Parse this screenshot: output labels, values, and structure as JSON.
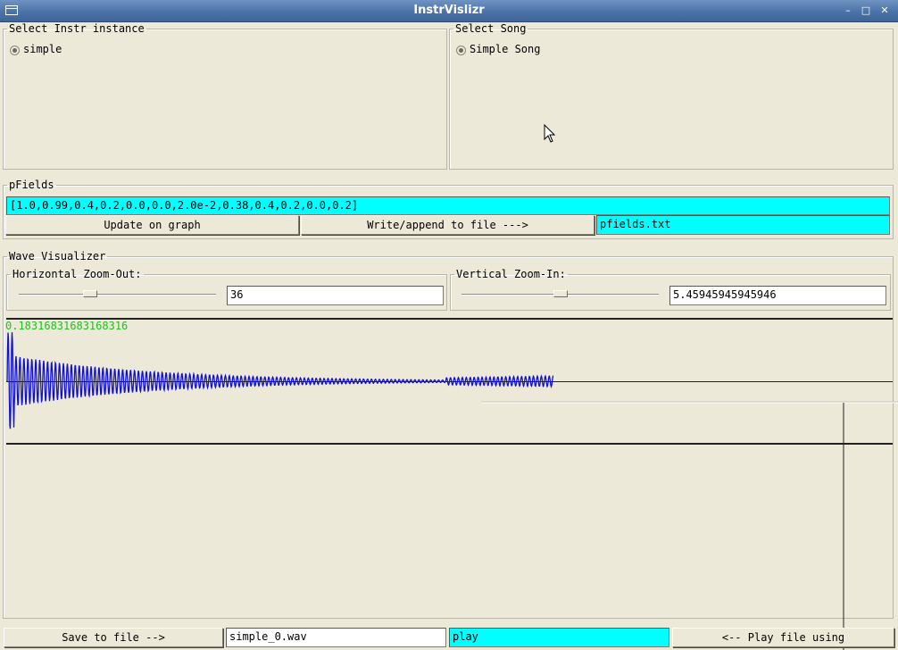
{
  "window": {
    "title": "InstrVislizr"
  },
  "instr_panel": {
    "legend": "Select Instr instance",
    "options": [
      {
        "label": "simple",
        "selected": true
      }
    ]
  },
  "song_panel": {
    "legend": "Select Song",
    "options": [
      {
        "label": "Simple Song",
        "selected": true
      }
    ]
  },
  "pfields": {
    "legend": "pFields",
    "value": "[1.0,0.99,0.4,0.2,0.0,0.0,2.0e-2,0.38,0.4,0.2,0.0,0.2]",
    "update_label": "Update on graph",
    "write_label": "Write/append to file --->",
    "filename": "pfields.txt"
  },
  "visualizer": {
    "legend": "Wave Visualizer",
    "horizontal": {
      "legend": "Horizontal Zoom-Out:",
      "value": "36",
      "slider_fraction": 0.36
    },
    "vertical": {
      "legend": "Vertical Zoom-In:",
      "value": "5.45945945945946",
      "slider_fraction": 0.5
    },
    "readout": "0.18316831683168316",
    "wave_color": "#1010d0"
  },
  "footer": {
    "save_label": "Save to file -->",
    "save_filename": "simple_0.wav",
    "play_command": "play",
    "play_label": "<-- Play file using"
  },
  "colors": {
    "field_cyan": "#00ffff",
    "readout_green": "#22c020",
    "bg": "#ece9d8"
  }
}
